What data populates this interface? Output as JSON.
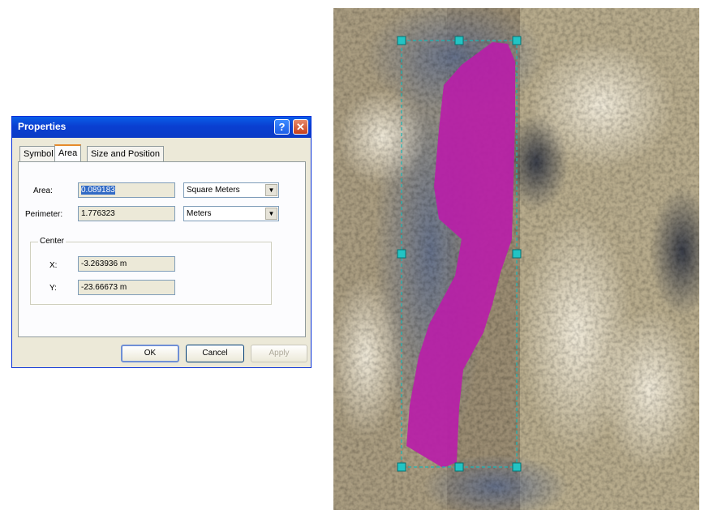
{
  "dialog": {
    "title": "Properties",
    "help_label": "?",
    "close_label": "✕",
    "tabs": [
      {
        "label": "Symbol"
      },
      {
        "label": "Area"
      },
      {
        "label": "Size and Position"
      }
    ],
    "area": {
      "label": "Area:",
      "value": "0.089183",
      "unit": "Square Meters"
    },
    "perimeter": {
      "label": "Perimeter:",
      "value": "1.776323",
      "unit": "Meters"
    },
    "center": {
      "label": "Center",
      "x_label": "X:",
      "x_value": "-3.263936 m",
      "y_label": "Y:",
      "y_value": "-23.66673 m"
    },
    "buttons": {
      "ok": "OK",
      "cancel": "Cancel",
      "apply": "Apply"
    }
  },
  "colors": {
    "polygon_fill": "#b81ea8",
    "selection_handle": "#22c4c4",
    "selection_outline": "#1ab5b5",
    "title_bar": "#0b3bc6"
  }
}
